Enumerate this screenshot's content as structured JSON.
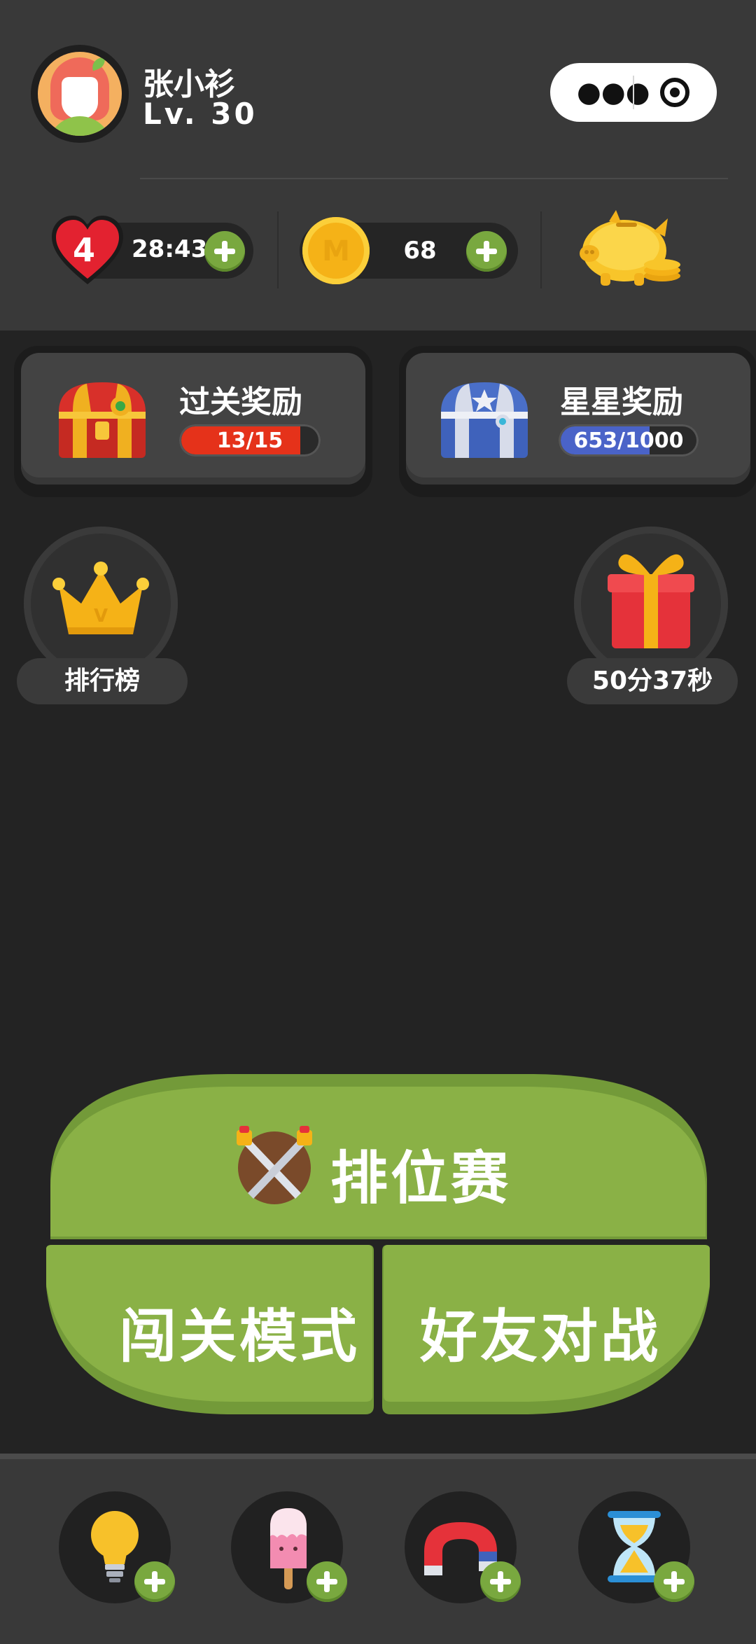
{
  "profile": {
    "name": "张小衫",
    "level": "Lv. 30"
  },
  "capsule": {
    "more_icon": "more-dots-icon",
    "close_icon": "target-icon"
  },
  "resources": {
    "lives": "4",
    "life_timer": "28:43",
    "coins": "68",
    "piggy_bank_icon": "piggy-bank-icon"
  },
  "rewards": {
    "level_reward": {
      "title": "过关奖励",
      "progress": "13/15",
      "current": 13,
      "total": 15,
      "color": "#e5321a"
    },
    "star_reward": {
      "title": "星星奖励",
      "progress": "653/1000",
      "current": 653,
      "total": 1000,
      "color": "#4a63c8"
    }
  },
  "side": {
    "leaderboard_label": "排行榜",
    "gift_timer": "50分37秒"
  },
  "modes": {
    "ranked": "排位赛",
    "adventure": "闯关模式",
    "friend_battle": "好友对战"
  },
  "tools": [
    "lightbulb-icon",
    "popsicle-icon",
    "magnet-icon",
    "hourglass-icon"
  ],
  "colors": {
    "accent_green": "#8ab146",
    "plus_green": "#79a83f",
    "background": "#232323"
  }
}
